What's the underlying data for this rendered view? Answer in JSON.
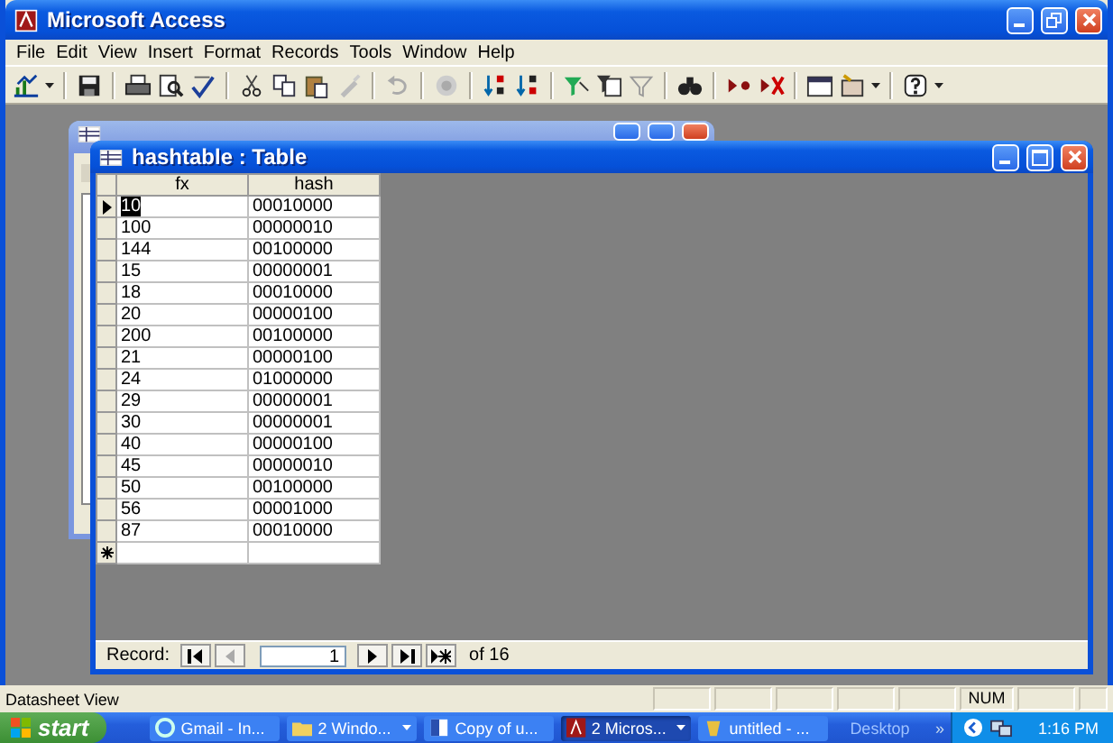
{
  "app": {
    "title": "Microsoft Access"
  },
  "menu": [
    "File",
    "Edit",
    "View",
    "Insert",
    "Format",
    "Records",
    "Tools",
    "Window",
    "Help"
  ],
  "table_window": {
    "title": "hashtable : Table",
    "columns": [
      "fx",
      "hash"
    ],
    "rows": [
      {
        "fx": "10",
        "hash": "00010000",
        "selected": true
      },
      {
        "fx": "100",
        "hash": "00000010",
        "selected": false
      },
      {
        "fx": "144",
        "hash": "00100000",
        "selected": false
      },
      {
        "fx": "15",
        "hash": "00000001",
        "selected": false
      },
      {
        "fx": "18",
        "hash": "00010000",
        "selected": false
      },
      {
        "fx": "20",
        "hash": "00000100",
        "selected": false
      },
      {
        "fx": "200",
        "hash": "00100000",
        "selected": false
      },
      {
        "fx": "21",
        "hash": "00000100",
        "selected": false
      },
      {
        "fx": "24",
        "hash": "01000000",
        "selected": false
      },
      {
        "fx": "29",
        "hash": "00000001",
        "selected": false
      },
      {
        "fx": "30",
        "hash": "00000001",
        "selected": false
      },
      {
        "fx": "40",
        "hash": "00000100",
        "selected": false
      },
      {
        "fx": "45",
        "hash": "00000010",
        "selected": false
      },
      {
        "fx": "50",
        "hash": "00100000",
        "selected": false
      },
      {
        "fx": "56",
        "hash": "00001000",
        "selected": false
      },
      {
        "fx": "87",
        "hash": "00010000",
        "selected": false
      }
    ],
    "record_nav": {
      "label": "Record:",
      "current": "1",
      "total": "of 16"
    }
  },
  "status_bar": {
    "text": "Datasheet View",
    "indicators": [
      "NUM"
    ]
  },
  "taskbar": {
    "start": "start",
    "tasks": [
      {
        "label": "Gmail - In...",
        "selected": false,
        "dropdown": false
      },
      {
        "label": "2 Windo...",
        "selected": false,
        "dropdown": true
      },
      {
        "label": "Copy of u...",
        "selected": false,
        "dropdown": false
      },
      {
        "label": "2 Micros...",
        "selected": true,
        "dropdown": true
      },
      {
        "label": "untitled - ...",
        "selected": false,
        "dropdown": false
      }
    ],
    "desktop": "Desktop",
    "chevron": "»",
    "clock": "1:16 PM"
  }
}
